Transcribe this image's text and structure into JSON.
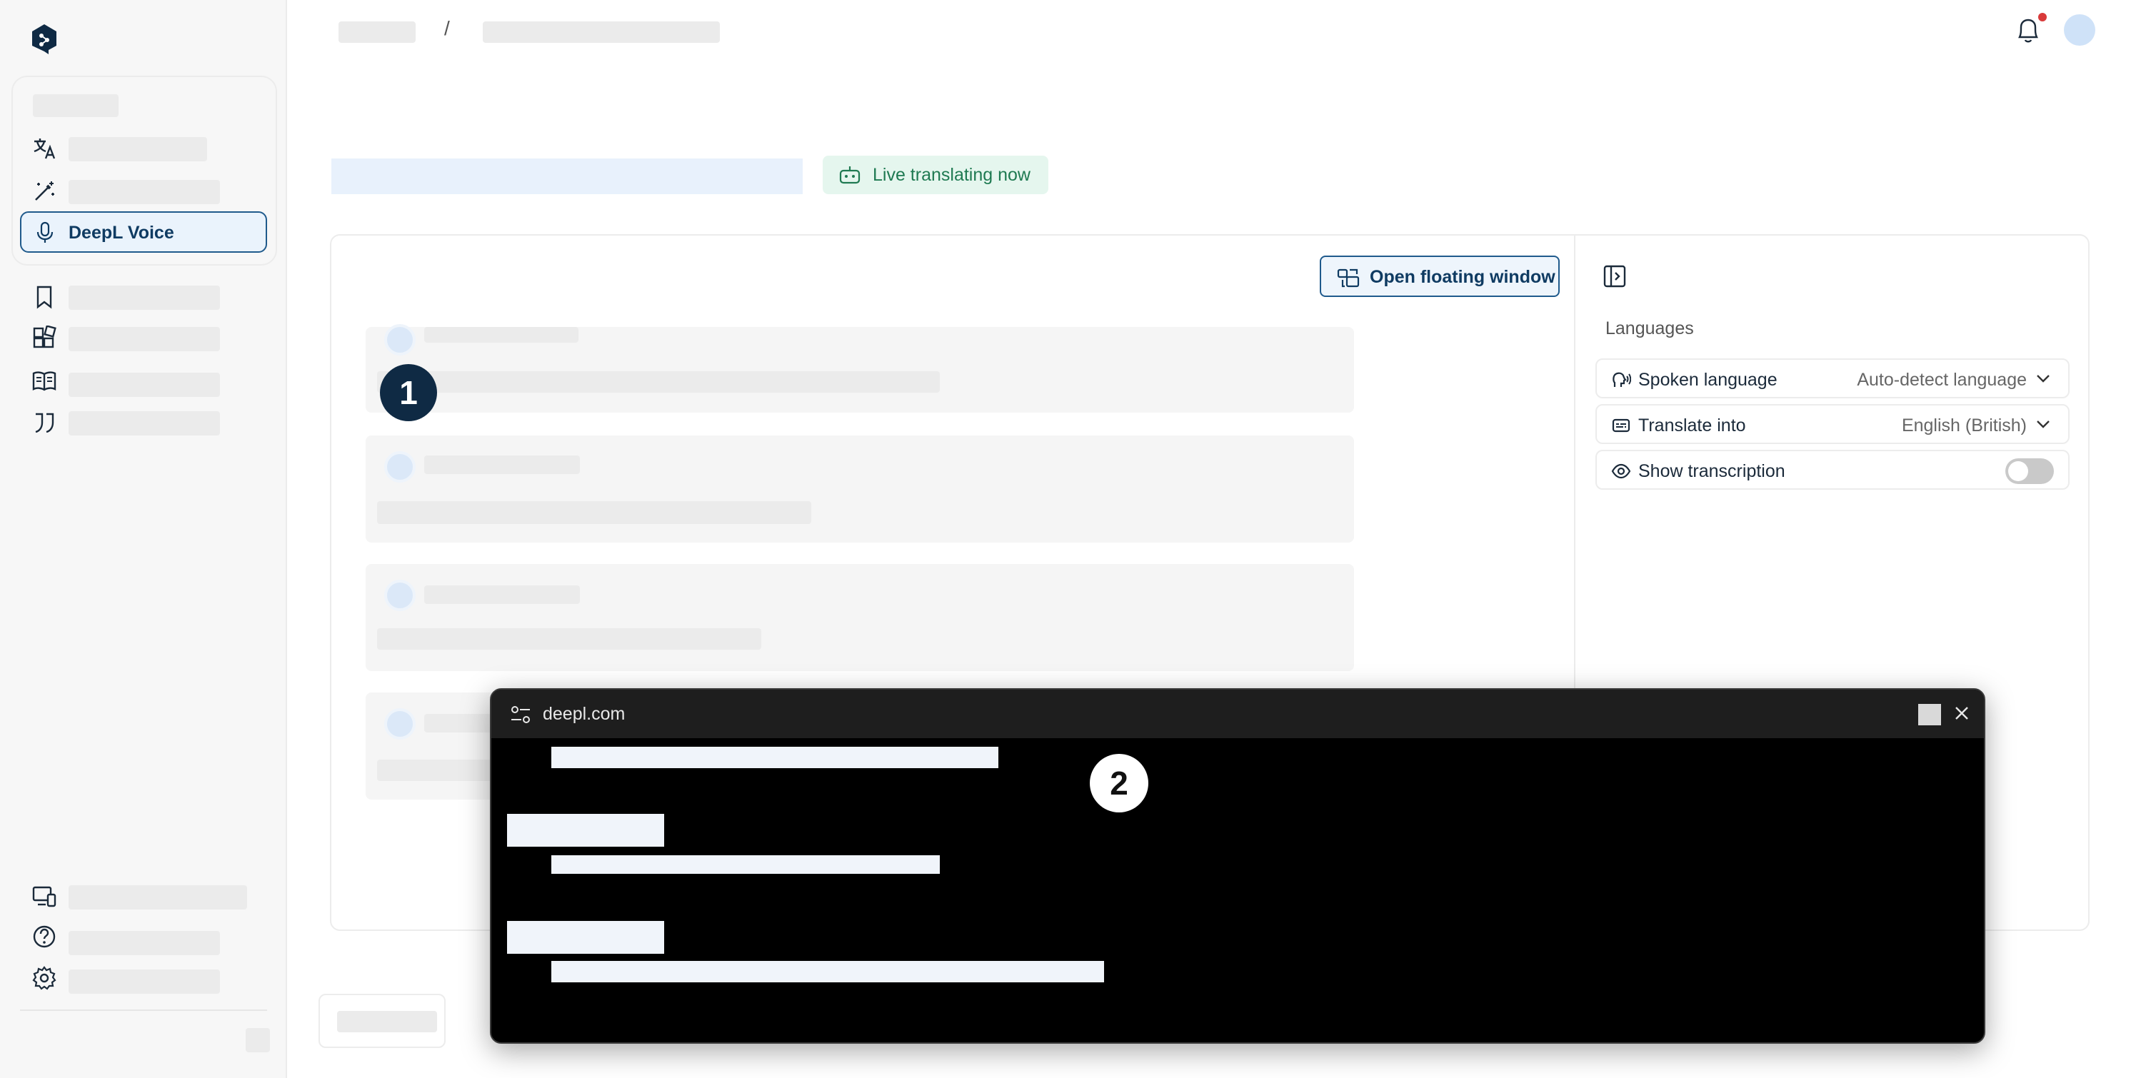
{
  "sidebar": {
    "active_item": "DeepL Voice"
  },
  "breadcrumb": {
    "separator": "/"
  },
  "header": {
    "live_badge": "Live translating now"
  },
  "main": {
    "open_floating_button": "Open floating window",
    "annotation_1": "1",
    "annotation_2": "2"
  },
  "languages_panel": {
    "heading": "Languages",
    "spoken": {
      "label": "Spoken language",
      "value": "Auto-detect language"
    },
    "translate": {
      "label": "Translate into",
      "value": "English (British)"
    },
    "transcription": {
      "label": "Show transcription",
      "enabled": false
    }
  },
  "floating_window": {
    "title": "deepl.com"
  },
  "colors": {
    "brand": "#0f2a44",
    "accent": "#1f5a8c",
    "live_green": "#1f7a52",
    "notification": "#d93a3a"
  }
}
